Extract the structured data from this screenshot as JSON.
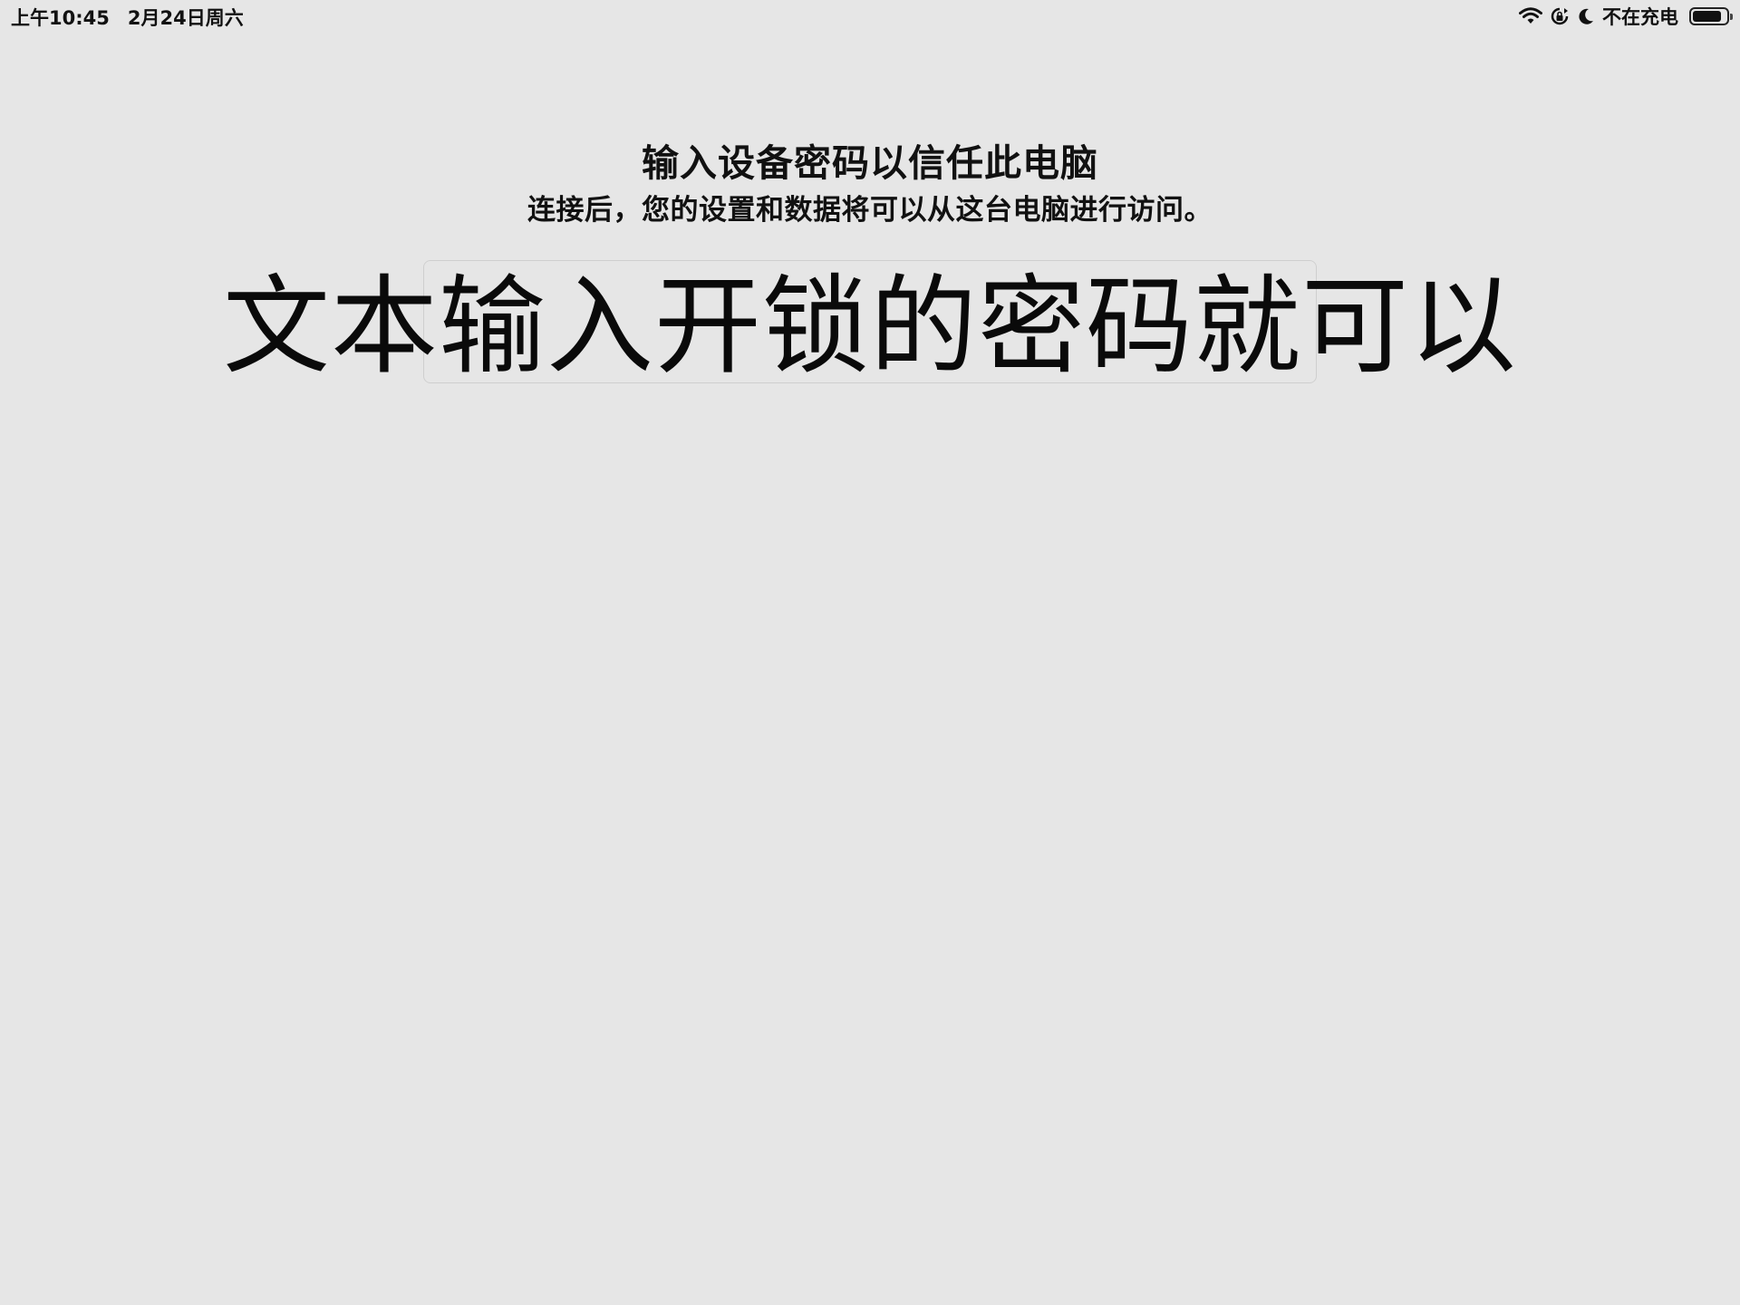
{
  "status_bar": {
    "time": "上午10:45",
    "date": "2月24日周六",
    "charging_status": "不在充电",
    "battery_level": 0.85,
    "icons": [
      "wifi-icon",
      "orientation-lock-icon",
      "moon-icon",
      "battery-icon"
    ]
  },
  "trust_prompt": {
    "title": "输入设备密码以信任此电脑",
    "subtitle": "连接后，您的设置和数据将可以从这台电脑进行访问。",
    "passcode_value": ""
  },
  "annotation": {
    "text": "文本输入开锁的密码就可以"
  }
}
